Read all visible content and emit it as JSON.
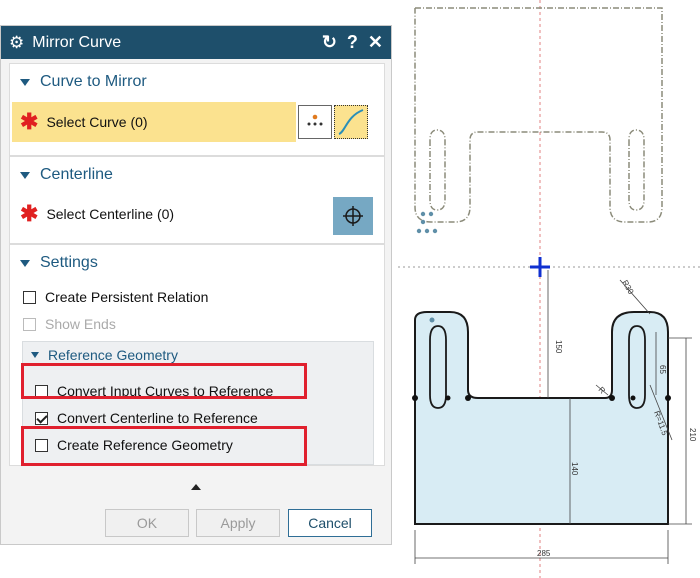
{
  "dialog": {
    "title": "Mirror Curve",
    "reset_icon": "reset-icon",
    "help_label": "?",
    "close_label": "✕",
    "curve_section": {
      "header": "Curve to Mirror",
      "select_label": "Select Curve (0)",
      "highlight_color": "#fbe28f"
    },
    "centerline_section": {
      "header": "Centerline",
      "select_label": "Select Centerline (0)"
    },
    "settings_section": {
      "header": "Settings",
      "create_persistent_relation": "Create Persistent Relation",
      "show_ends": "Show Ends",
      "reference_geometry_header": "Reference Geometry",
      "convert_input_curves": "Convert Input Curves to Reference",
      "convert_centerline": "Convert Centerline to Reference",
      "create_reference_geometry": "Create Reference Geometry"
    },
    "buttons": {
      "ok": "OK",
      "apply": "Apply",
      "cancel": "Cancel"
    }
  },
  "drawing": {
    "dimensions": {
      "d150": "150",
      "d65": "65",
      "d210": "210",
      "d140": "140",
      "d285": "285",
      "r30": "R30",
      "r115": "R=11.5",
      "r_small": "R"
    }
  }
}
